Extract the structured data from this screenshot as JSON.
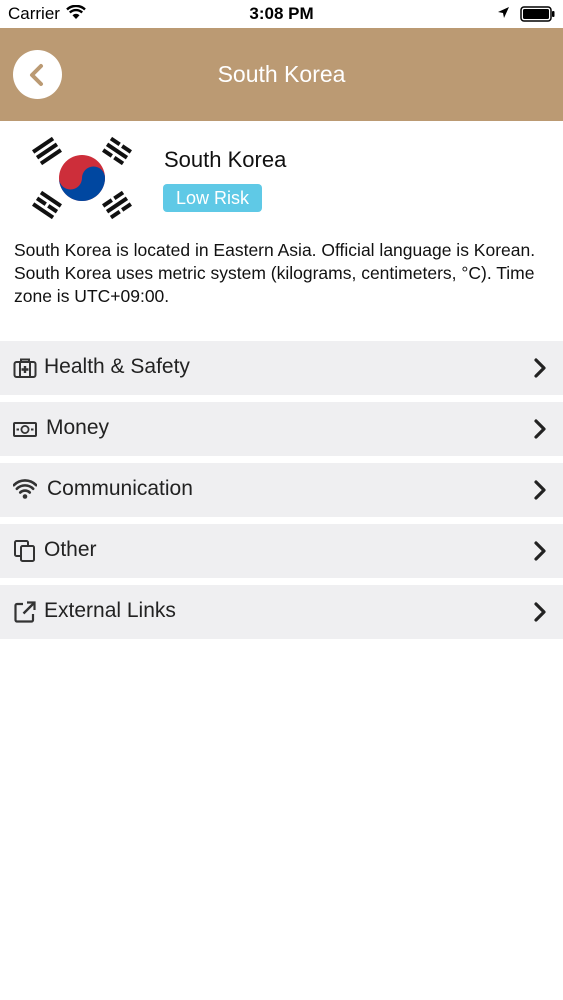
{
  "status_bar": {
    "carrier": "Carrier",
    "time": "3:08 PM"
  },
  "nav": {
    "title": "South Korea",
    "back_icon": "chevron-left-icon"
  },
  "country": {
    "name": "South Korea",
    "risk": "Low Risk",
    "risk_color": "#5fc9e6",
    "description": "South Korea is located in Eastern Asia. Official language is Korean. South Korea uses metric system (kilograms, centimeters, °C). Time zone is UTC+09:00."
  },
  "menu": {
    "items": [
      {
        "label": "Health & Safety",
        "icon": "medkit-icon"
      },
      {
        "label": "Money",
        "icon": "money-icon"
      },
      {
        "label": "Communication",
        "icon": "wifi-icon"
      },
      {
        "label": "Other",
        "icon": "copy-icon"
      },
      {
        "label": "External Links",
        "icon": "external-link-icon"
      }
    ]
  },
  "colors": {
    "nav_background": "#bb9a73",
    "row_background": "#efeff1",
    "badge": "#5fc9e6"
  }
}
